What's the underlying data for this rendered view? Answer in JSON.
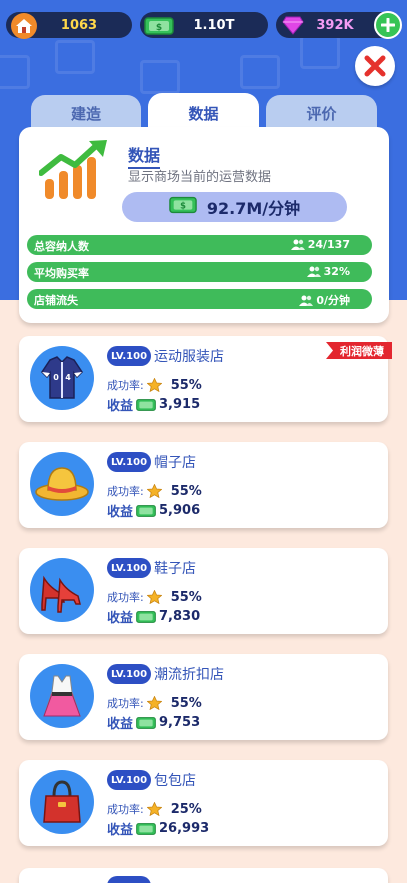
{
  "resources": {
    "coins": "1063",
    "cash": "1.10T",
    "gems": "392K"
  },
  "tabs": [
    {
      "label": "建造",
      "active": false
    },
    {
      "label": "数据",
      "active": true
    },
    {
      "label": "评价",
      "active": false
    }
  ],
  "stats": {
    "title": "数据",
    "subtitle": "显示商场当前的运营数据",
    "rate": "92.7M/分钟",
    "rows": [
      {
        "label": "总容纳人数",
        "value": "24/137"
      },
      {
        "label": "平均购买率",
        "value": "32%"
      },
      {
        "label": "店铺流失",
        "value": "0/分钟"
      }
    ]
  },
  "shops": [
    {
      "level": "LV.100",
      "name": "运动服装店",
      "rate_label": "成功率:",
      "rate": "55%",
      "income_label": "收益",
      "income": "3,915",
      "ribbon": "利润微薄",
      "icon": "jacket-icon"
    },
    {
      "level": "LV.100",
      "name": "帽子店",
      "rate_label": "成功率:",
      "rate": "55%",
      "income_label": "收益",
      "income": "5,906",
      "icon": "hat-icon"
    },
    {
      "level": "LV.100",
      "name": "鞋子店",
      "rate_label": "成功率:",
      "rate": "55%",
      "income_label": "收益",
      "income": "7,830",
      "icon": "heels-icon"
    },
    {
      "level": "LV.100",
      "name": "潮流折扣店",
      "rate_label": "成功率:",
      "rate": "55%",
      "income_label": "收益",
      "income": "9,753",
      "icon": "dress-icon"
    },
    {
      "level": "LV.100",
      "name": "包包店",
      "rate_label": "成功率:",
      "rate": "25%",
      "income_label": "收益",
      "income": "26,993",
      "icon": "handbag-icon"
    }
  ],
  "colors": {
    "accent": "#3b6ee0",
    "stat_bar": "#3fbb5a",
    "ribbon": "#e3262f",
    "background": "#fde9de"
  }
}
